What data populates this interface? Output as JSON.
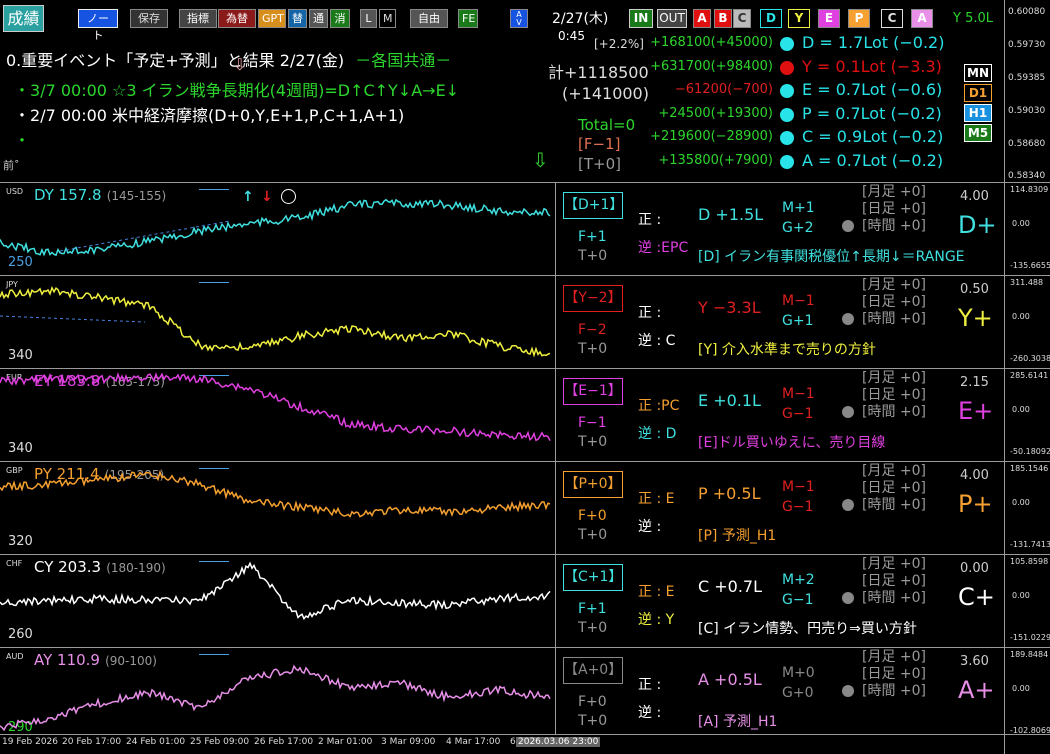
{
  "toolbar": {
    "seiseki": "成績",
    "note": "ノート",
    "save": "保存",
    "shihyo": "指標",
    "kawase": "為替",
    "gpt": "GPT",
    "kae": "替",
    "tsuu": "通",
    "kesu": "消",
    "l": "L",
    "m": "M",
    "jiyu": "自由",
    "fe": "FE",
    "av": "A\nV"
  },
  "header": {
    "date": "2/27(木)",
    "time": "0:45",
    "in": "IN",
    "out": "OUT",
    "pads": [
      "A",
      "B",
      "C",
      "D",
      "Y",
      "E",
      "P",
      "C",
      "A"
    ],
    "y_lot": "Y 5.0L",
    "pct": "[+2.2%]",
    "total_label": "計+1118500",
    "total_sub": "(+141000)",
    "total_zero": "Total=0",
    "f_minus": "[F−1]",
    "t_zero": "[T+0]"
  },
  "events": {
    "headline": "0.重要イベント「予定+予測」と結果  2/27(金)",
    "headline_tag": "－各国共通－",
    "items": [
      "3/7 00:00 ☆3 イラン戦争長期化(4週間)=D↑C↑Y↓A→E↓",
      "2/7 00:00 米中経済摩擦(D+0,Y,E+1,P,C+1,A+1)",
      "",
      ""
    ],
    "foot": "前˚"
  },
  "positions": [
    {
      "pl": "+168100(+45000)",
      "label": "D = 1.7Lot (−0.2)",
      "color": "#28e3e8",
      "pl_color": "#2dd62d"
    },
    {
      "pl": "+631700(+98400)",
      "label": "Y = 0.1Lot (−3.3)",
      "color": "#e01010",
      "pl_color": "#2dd62d"
    },
    {
      "pl": "−61200(−700)",
      "label": "E = 0.7Lot (−0.6)",
      "color": "#28e3e8",
      "pl_color": "#e02020"
    },
    {
      "pl": "+24500(+19300)",
      "label": "P = 0.7Lot (−0.2)",
      "color": "#28e3e8",
      "pl_color": "#2dd62d"
    },
    {
      "pl": "+219600(−28900)",
      "label": "C = 0.9Lot (−0.2)",
      "color": "#28e3e8",
      "pl_color": "#2dd62d"
    },
    {
      "pl": "+135800(+7900)",
      "label": "A = 0.7Lot (−0.2)",
      "color": "#28e3e8",
      "pl_color": "#2dd62d"
    }
  ],
  "timeframes": [
    "MN",
    "D1",
    "H1",
    "M5"
  ],
  "main_axis": [
    "0.60080",
    "0.59730",
    "0.59385",
    "0.59030",
    "0.58680",
    "0.58340"
  ],
  "panes": [
    {
      "id": "usd",
      "name": "USD",
      "title": "DY 157.8",
      "range": "(145-155)",
      "num": "250",
      "color": "#3fe0df",
      "badge": "【D+1】",
      "badge_color": "#3fe0df",
      "line1": "F+1",
      "line2": "T+0",
      "sei": "正 :",
      "sei_extra": "",
      "gyaku": "逆 :EPC",
      "gyaku_color": "#e040e0",
      "lot": "D +1.5L",
      "lot_color": "#3fe0df",
      "m": "M+1",
      "g": "G+2",
      "mg_color": "#3fe0df",
      "ctl": [
        "[月足 +0]",
        "[日足 +0]",
        "[時間 +0]"
      ],
      "note": "[D] イラン有事関税優位↑長期↓＝RANGE",
      "note_color": "#3fe0df",
      "score": "4.00",
      "letter": "D+",
      "letter_color": "#3fe0df",
      "axis": [
        "114.8309",
        "0.00",
        "-135.66551"
      ]
    },
    {
      "id": "jpy",
      "name": "JPY",
      "title": "",
      "range": "",
      "num": "340",
      "color": "#f0f040",
      "badge": "【Y−2】",
      "badge_color": "#e02020",
      "line1": "F−2",
      "line2": "T+0",
      "sei": "正 :",
      "sei_extra": "",
      "gyaku": "逆 : C",
      "gyaku_color": "#ffffff",
      "lot": "Y −3.3L",
      "lot_color": "#e02020",
      "m": "M−1",
      "g": "G+1",
      "mg_color": "#e02020",
      "ctl": [
        "[月足 +0]",
        "[日足 +0]",
        "[時間 +0]"
      ],
      "note": "[Y] 介入水準まで売りの方針",
      "note_color": "#f0f040",
      "score": "0.50",
      "letter": "Y+",
      "letter_color": "#f0f040",
      "axis": [
        "311.488",
        "0.00",
        "-260.3038"
      ]
    },
    {
      "id": "eur",
      "name": "EUR",
      "title": "EY 183.8",
      "range": "(165-175)",
      "num": "340",
      "color": "#e040e0",
      "badge": "【E−1】",
      "badge_color": "#e040e0",
      "line1": "F−1",
      "line2": "T+0",
      "sei": "正 :PC",
      "sei_extra": "",
      "gyaku": "逆 : D",
      "gyaku_color": "#3fe0df",
      "lot": "E +0.1L",
      "lot_color": "#3fe0df",
      "m": "M−1",
      "g": "G−1",
      "mg_color": "#e02020",
      "ctl": [
        "[月足 +0]",
        "[日足 +0]",
        "[時間 +0]"
      ],
      "note": "[E]ドル買いゆえに、売り目線",
      "note_color": "#e040e0",
      "score": "2.15",
      "letter": "E+",
      "letter_color": "#e040e0",
      "axis": [
        "285.6141",
        "0.00",
        "-50.18092"
      ]
    },
    {
      "id": "gbp",
      "name": "GBP",
      "title": "PY 211.4",
      "range": "(195-205)",
      "num": "320",
      "color": "#f5a030",
      "badge": "【P+0】",
      "badge_color": "#f5a030",
      "line1": "F+0",
      "line2": "T+0",
      "sei": "正 : E",
      "sei_extra": "",
      "gyaku": "逆 :",
      "gyaku_color": "#ffffff",
      "lot": "P +0.5L",
      "lot_color": "#f5a030",
      "m": "M−1",
      "g": "G−1",
      "mg_color": "#e02020",
      "ctl": [
        "[月足 +0]",
        "[日足 +0]",
        "[時間 +0]"
      ],
      "note": "[P] 予測_H1",
      "note_color": "#f5a030",
      "score": "4.00",
      "letter": "P+",
      "letter_color": "#f5a030",
      "axis": [
        "185.1546",
        "0.00",
        "-131.7413"
      ]
    },
    {
      "id": "chf",
      "name": "CHF",
      "title": "CY 203.3",
      "range": "(180-190)",
      "num": "260",
      "color": "#ffffff",
      "badge": "【C+1】",
      "badge_color": "#3fe0df",
      "line1": "F+1",
      "line2": "T+0",
      "sei": "正 : E",
      "sei_extra": "",
      "gyaku": "逆 : Y",
      "gyaku_color": "#f0f040",
      "lot": "C +0.7L",
      "lot_color": "#ffffff",
      "m": "M+2",
      "g": "G−1",
      "mg_color": "#3fe0df",
      "ctl": [
        "[月足 +0]",
        "[日足 +0]",
        "[時間 +0]"
      ],
      "note": "[C] イラン情勢、円売り⇒買い方針",
      "note_color": "#ffffff",
      "score": "0.00",
      "letter": "C+",
      "letter_color": "#ffffff",
      "axis": [
        "105.8598",
        "0.00",
        "-151.02299"
      ]
    },
    {
      "id": "aud",
      "name": "AUD",
      "title": "AY 110.9",
      "range": "(90-100)",
      "num": "290",
      "color": "#e890e8",
      "badge": "【A+0】",
      "badge_color": "#888888",
      "line1": "F+0",
      "line2": "T+0",
      "sei": "正 :",
      "sei_extra": "",
      "gyaku": "逆 :",
      "gyaku_color": "#ffffff",
      "lot": "A +0.5L",
      "lot_color": "#e890e8",
      "m": "M+0",
      "g": "G+0",
      "mg_color": "#888888",
      "ctl": [
        "[月足 +0]",
        "[日足 +0]",
        "[時間 +0]"
      ],
      "note": "[A] 予測_H1",
      "note_color": "#e890e8",
      "score": "3.60",
      "letter": "A+",
      "letter_color": "#e890e8",
      "axis": [
        "189.8484",
        "0.00",
        "-102.8069"
      ]
    }
  ],
  "x_axis": [
    "19 Feb 2026",
    "20 Feb 17:00",
    "24 Feb 01:00",
    "25 Feb 09:00",
    "26 Feb 17:00",
    "2 Mar 01:00",
    "3 Mar 09:00",
    "4 Mar 17:00",
    "6",
    "2026.03.06 23:00"
  ]
}
